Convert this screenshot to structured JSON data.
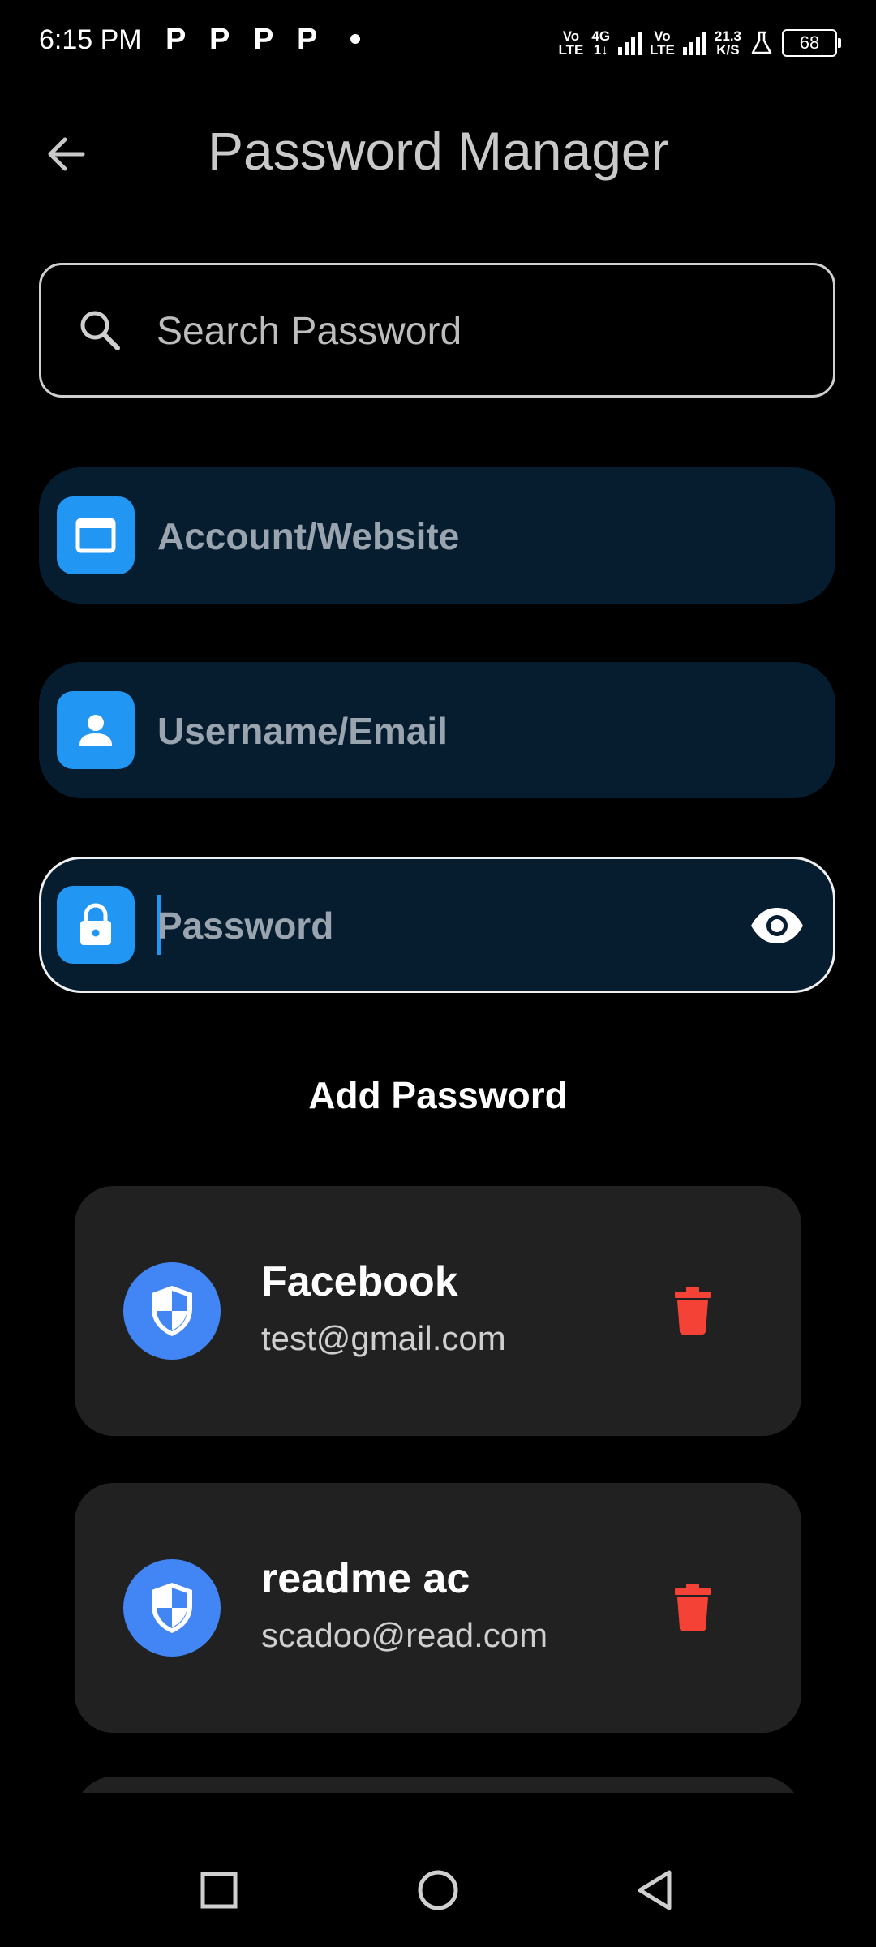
{
  "status_bar": {
    "time": "6:15 PM",
    "notification_icons": [
      "P",
      "P",
      "P",
      "P"
    ],
    "network_1": {
      "top": "Vo",
      "bottom": "LTE"
    },
    "network_4g": {
      "top": "4G",
      "bottom": "1↓"
    },
    "network_2": {
      "top": "Vo",
      "bottom": "LTE"
    },
    "speed": {
      "value": "21.3",
      "unit": "K/S"
    },
    "battery": "68"
  },
  "app_bar": {
    "title": "Password Manager",
    "back_icon": "arrow-left-icon"
  },
  "search": {
    "placeholder": "Search Password",
    "value": "",
    "icon": "search-icon"
  },
  "form": {
    "account": {
      "placeholder": "Account/Website",
      "value": "",
      "icon": "browser-window-icon"
    },
    "username": {
      "placeholder": "Username/Email",
      "value": "",
      "icon": "person-icon"
    },
    "password": {
      "placeholder": "Password",
      "value": "",
      "icon": "lock-icon",
      "toggle_icon": "eye-icon"
    },
    "submit_label": "Add Password"
  },
  "entries": [
    {
      "title": "Facebook",
      "subtitle": "test@gmail.com",
      "icon": "shield-icon",
      "action_icon": "trash-icon"
    },
    {
      "title": "readme ac",
      "subtitle": "scadoo@read.com",
      "icon": "shield-icon",
      "action_icon": "trash-icon"
    }
  ],
  "nav_bar": {
    "recents_icon": "square-icon",
    "home_icon": "circle-icon",
    "back_icon": "triangle-back-icon"
  },
  "colors": {
    "background": "#000000",
    "field_bg": "#061d30",
    "accent": "#2196f3",
    "card_bg": "#212121",
    "avatar": "#4285f4",
    "delete": "#f44336"
  }
}
